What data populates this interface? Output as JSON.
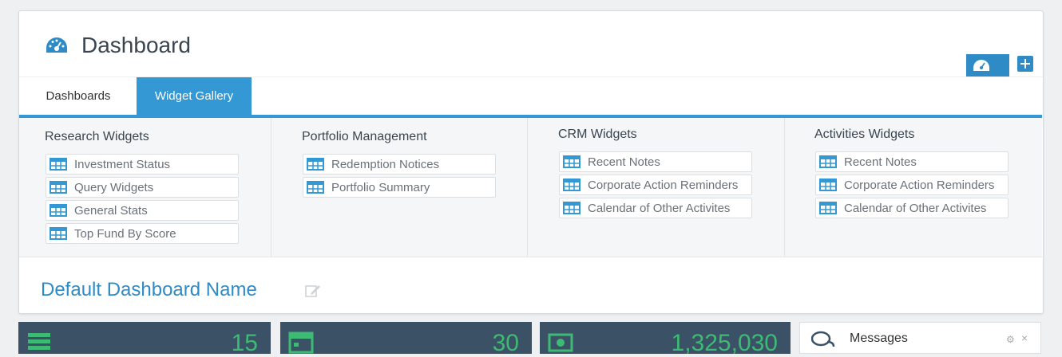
{
  "header": {
    "title": "Dashboard",
    "icon": "speedometer-icon"
  },
  "tabs": [
    {
      "label": "Dashboards",
      "active": false
    },
    {
      "label": "Widget Gallery",
      "active": true
    }
  ],
  "gallery": {
    "columns": [
      {
        "title": "Research Widgets",
        "items": [
          "Investment Status",
          "Query Widgets",
          "General Stats",
          "Top Fund By Score"
        ]
      },
      {
        "title": "Portfolio Management",
        "items": [
          "Redemption Notices",
          "Portfolio Summary"
        ]
      },
      {
        "title": "CRM Widgets",
        "items": [
          "Recent Notes",
          "Corporate Action Reminders",
          "Calendar of Other Activites"
        ]
      },
      {
        "title": "Activities Widgets",
        "items": [
          "Recent Notes",
          "Corporate Action Reminders",
          "Calendar of Other Activites"
        ]
      }
    ]
  },
  "dashboard": {
    "name": "Default Dashboard Name"
  },
  "stats": [
    {
      "value": "15",
      "icon": "list-icon"
    },
    {
      "value": "30",
      "icon": "calendar-icon"
    },
    {
      "value": "1,325,030",
      "icon": "money-icon"
    }
  ],
  "messages": {
    "title": "Messages",
    "close": "×",
    "gear": "⚙"
  },
  "colors": {
    "accent": "#3398d4",
    "stat_bg": "#3b5166",
    "stat_value": "#3dbb75"
  }
}
